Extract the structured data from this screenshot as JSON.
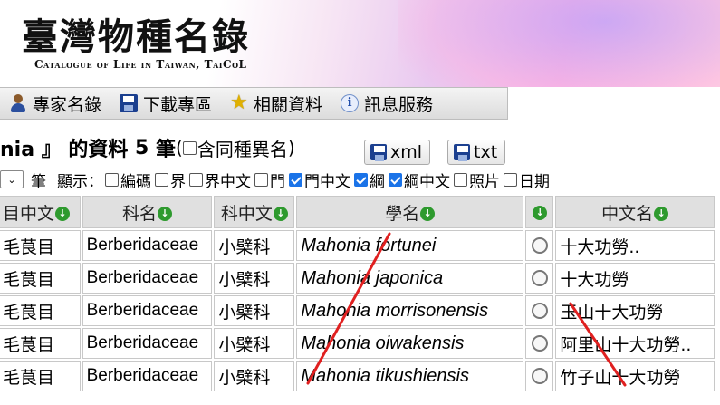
{
  "banner": {
    "title_cn": "臺灣物種名錄",
    "title_en": "Catalogue of Life in Taiwan, TaiCoL"
  },
  "menu": {
    "items": [
      {
        "label": "專家名錄",
        "icon": "person-icon"
      },
      {
        "label": "下載專區",
        "icon": "floppy-disk-icon"
      },
      {
        "label": "相關資料",
        "icon": "star-icon"
      },
      {
        "label": "訊息服務",
        "icon": "info-icon"
      }
    ]
  },
  "result": {
    "prefix": "nia 』 的資料 ",
    "count": "5",
    "count_unit": " 筆",
    "synonym_open": "(",
    "synonym_label": "含同種異名",
    "synonym_close": ")",
    "synonym_checked": false,
    "xml_label": "xml",
    "txt_label": "txt"
  },
  "display_options": {
    "per_page_unit": "筆",
    "display_label": "顯示：",
    "options": [
      {
        "label": "編碼",
        "checked": false
      },
      {
        "label": "界",
        "checked": false
      },
      {
        "label": "界中文",
        "checked": false
      },
      {
        "label": "門",
        "checked": false
      },
      {
        "label": "門中文",
        "checked": true
      },
      {
        "label": "綱",
        "checked": true
      },
      {
        "label": "綱中文",
        "checked": true
      },
      {
        "label": "照片",
        "checked": false
      },
      {
        "label": "日期",
        "checked": false
      }
    ]
  },
  "table": {
    "headers": {
      "order_cn": "目中文",
      "family": "科名",
      "family_cn": "科中文",
      "scientific": "學名",
      "status": "",
      "common_cn": "中文名"
    },
    "rows": [
      {
        "order_cn": "毛茛目",
        "family": "Berberidaceae",
        "family_cn": "小檗科",
        "scientific": "Mahonia fortunei",
        "common_cn": "十大功勞.."
      },
      {
        "order_cn": "毛茛目",
        "family": "Berberidaceae",
        "family_cn": "小檗科",
        "scientific": "Mahonia japonica",
        "common_cn": "十大功勞"
      },
      {
        "order_cn": "毛茛目",
        "family": "Berberidaceae",
        "family_cn": "小檗科",
        "scientific": "Mahonia morrisonensis",
        "common_cn": "玉山十大功勞"
      },
      {
        "order_cn": "毛茛目",
        "family": "Berberidaceae",
        "family_cn": "小檗科",
        "scientific": "Mahonia oiwakensis",
        "common_cn": "阿里山十大功勞.."
      },
      {
        "order_cn": "毛茛目",
        "family": "Berberidaceae",
        "family_cn": "小檗科",
        "scientific": "Mahonia tikushiensis",
        "common_cn": "竹子山十大功勞"
      }
    ]
  },
  "colors": {
    "sort_icon": "#2e9a2e",
    "checkbox_on": "#1a73e8",
    "annotation_stroke": "#e02020"
  }
}
